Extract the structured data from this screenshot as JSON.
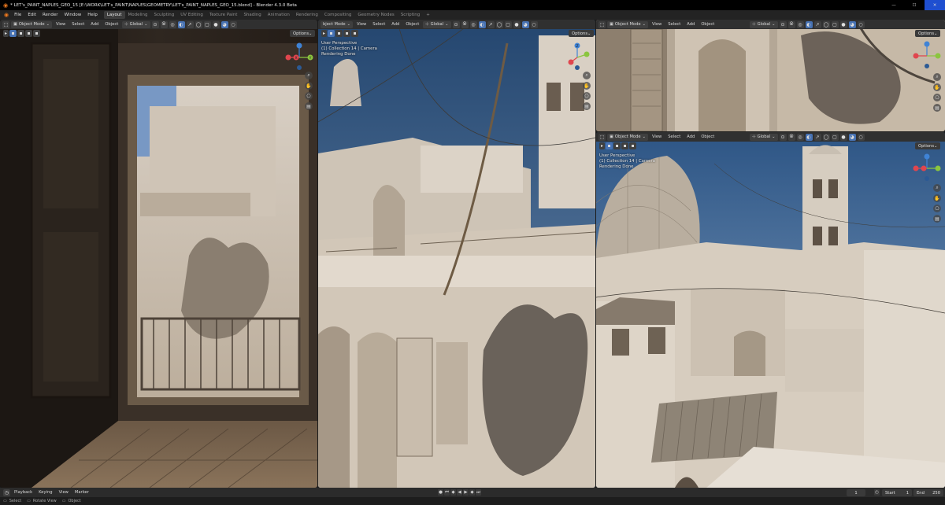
{
  "window": {
    "title": "* LET's_PAINT_NAPLES_GEO_15 [E:\\WORK\\LET's_PAINT\\NAPLES\\GEOMETRY\\LET's_PAINT_NAPLES_GEO_15.blend] - Blender 4.3.0 Beta",
    "minimize": "—",
    "maximize": "☐",
    "close": "✕"
  },
  "menu": {
    "items": [
      "File",
      "Edit",
      "Render",
      "Window",
      "Help"
    ],
    "workspaces": [
      "Layout",
      "Modeling",
      "Sculpting",
      "UV Editing",
      "Texture Paint",
      "Shading",
      "Animation",
      "Rendering",
      "Compositing",
      "Geometry Nodes",
      "Scripting"
    ],
    "active_workspace": "Layout",
    "add_tab": "+"
  },
  "viewport_header": {
    "mode": "Object Mode",
    "mode_short": "bject Mode",
    "menus": [
      "View",
      "Select",
      "Add",
      "Object"
    ],
    "transform": "Global",
    "options": "Options"
  },
  "overlay_text": {
    "perspective": "User Perspective",
    "collection": "(1) Collection 14 | Camera",
    "status": "Rendering Done"
  },
  "gizmo": {
    "x": "X",
    "y": "Y",
    "z": "Z",
    "colors": {
      "x": "#e0464e",
      "y": "#8bc53f",
      "z": "#3f83d6"
    }
  },
  "timeline": {
    "menus": [
      "Playback",
      "Keying",
      "View",
      "Marker"
    ],
    "current_frame": "1",
    "start_label": "Start",
    "start_value": "1",
    "end_label": "End",
    "end_value": "250"
  },
  "statusbar": {
    "items": [
      "Select",
      "Rotate View",
      "Object"
    ]
  },
  "colors": {
    "accent": "#4772b3",
    "header": "#303030",
    "background": "#1b1b1b"
  }
}
